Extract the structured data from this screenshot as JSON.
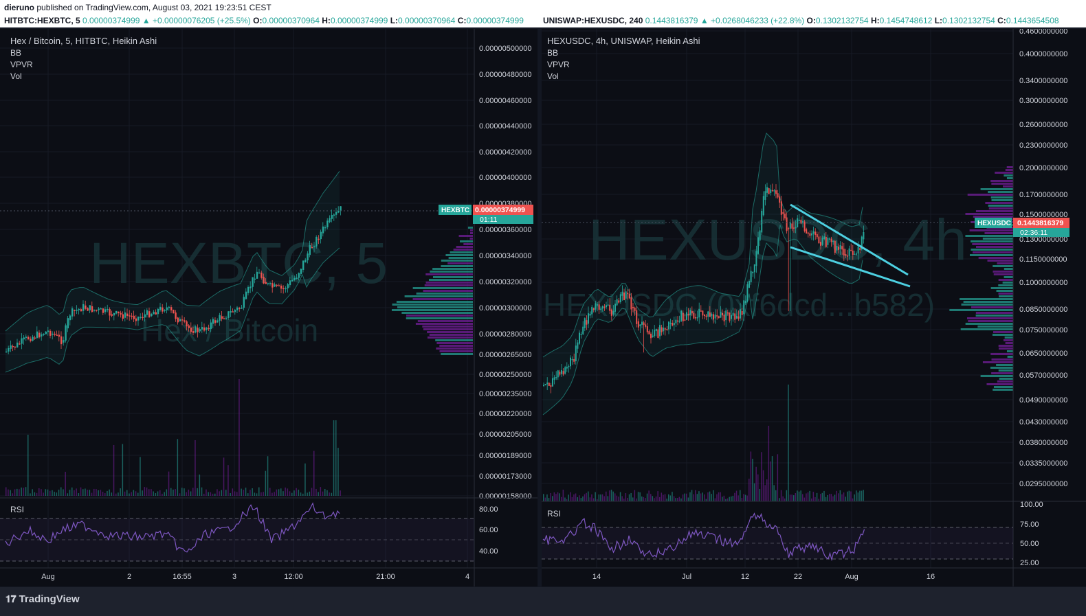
{
  "header": {
    "author": "dieruno",
    "published_text": "published on TradingView.com, August 03, 2021 19:23:51 CEST"
  },
  "left": {
    "symbol_line": "HITBTC:HEXBTC, 5",
    "last": "0.00000374999",
    "change": "+0.00000076205 (+25.5%)",
    "o_label": "O:",
    "o": "0.00000370964",
    "h_label": "H:",
    "h": "0.00000374999",
    "l_label": "L:",
    "l": "0.00000370964",
    "c_label": "C:",
    "c": "0.00000374999",
    "title": "Hex / Bitcoin, 5, HITBTC, Heikin Ashi",
    "indicators": [
      "BB",
      "VPVR",
      "Vol"
    ],
    "watermark": "HEXBTC, 5",
    "watermark_sub": "Hex / Bitcoin",
    "price_tag_symbol": "HEXBTC",
    "price_tag_value": "0.00000374999",
    "countdown": "01:11",
    "price_ticks": [
      "0.00000500000",
      "0.00000480000",
      "0.00000460000",
      "0.00000440000",
      "0.00000420000",
      "0.00000400000",
      "0.00000380000",
      "0.00000360000",
      "0.00000340000",
      "0.00000320000",
      "0.00000300000",
      "0.00000280000",
      "0.00000265000",
      "0.00000250000",
      "0.00000235000",
      "0.00000220000",
      "0.00000205000",
      "0.00000189000",
      "0.00000173000",
      "0.00000158000"
    ],
    "rsi_label": "RSI",
    "rsi_ticks": [
      "80.00",
      "60.00",
      "40.00"
    ],
    "time_ticks": [
      "Aug",
      "2",
      "16:55",
      "3",
      "12:00",
      "21:00",
      "4"
    ],
    "colors": {
      "up": "#26a69a",
      "down": "#ef5350",
      "bb": "#26a69a",
      "rsi": "#7e57c2",
      "vol": "#7b1fa2"
    }
  },
  "right": {
    "symbol_line": "UNISWAP:HEXUSDC, 240",
    "last": "0.1443816379",
    "change": "+0.0268046233 (+22.8%)",
    "o_label": "O:",
    "o": "0.1302132754",
    "h_label": "H:",
    "h": "0.1454748612",
    "l_label": "L:",
    "l": "0.1302132754",
    "c_label": "C:",
    "c": "0.1443654508",
    "title": "HEXUSDC, 4h, UNISWAP, Heikin Ashi",
    "indicators": [
      "BB",
      "VPVR",
      "Vol"
    ],
    "watermark": "HEXUSDC, 4h",
    "watermark_sub": "HEXUSDC (0xf6dcd...b582)",
    "price_tag_symbol": "HEXUSDC",
    "price_tag_value": "0.1443816379",
    "countdown": "02:36:11",
    "price_ticks": [
      "0.4600000000",
      "0.4000000000",
      "0.3400000000",
      "0.3000000000",
      "0.2600000000",
      "0.2300000000",
      "0.2000000000",
      "0.1700000000",
      "0.1500000000",
      "0.1300000000",
      "0.1150000000",
      "0.1000000000",
      "0.0850000000",
      "0.0750000000",
      "0.0650000000",
      "0.0570000000",
      "0.0490000000",
      "0.0430000000",
      "0.0380000000",
      "0.0335000000",
      "0.0295000000"
    ],
    "rsi_label": "RSI",
    "rsi_ticks": [
      "100.00",
      "75.00",
      "50.00",
      "25.00"
    ],
    "time_ticks": [
      "14",
      "Jul",
      "12",
      "22",
      "Aug",
      "16"
    ],
    "colors": {
      "up": "#26a69a",
      "down": "#ef5350",
      "wedge": "#4dd0e1",
      "rsi": "#7e57c2"
    }
  },
  "chart_data": [
    {
      "type": "candlestick",
      "title": "Hex / Bitcoin, 5, HITBTC, Heikin Ashi",
      "x_ticks": [
        "Aug",
        "2",
        "16:55",
        "3",
        "12:00",
        "21:00",
        "4"
      ],
      "approx_close_path": [
        {
          "x": "Aug 1",
          "y": 2.7e-06
        },
        {
          "x": "Aug 1 12:00",
          "y": 2.93e-06
        },
        {
          "x": "Aug 2",
          "y": 2.98e-06
        },
        {
          "x": "16:55",
          "y": 2.98e-06
        },
        {
          "x": "Aug 2 21:00",
          "y": 2.78e-06
        },
        {
          "x": "Aug 3",
          "y": 3e-06
        },
        {
          "x": "Aug 3 04:00",
          "y": 3.35e-06
        },
        {
          "x": "Aug 3 08:00",
          "y": 3.15e-06
        },
        {
          "x": "12:00",
          "y": 3.28e-06
        },
        {
          "x": "Aug 3 16:00",
          "y": 3.52e-06
        },
        {
          "x": "Aug 3 19:20",
          "y": 3.75e-06
        }
      ],
      "last_price": 3.74999e-06,
      "rsi_last": 73
    },
    {
      "type": "candlestick",
      "title": "HEXUSDC, 4h, UNISWAP, Heikin Ashi",
      "x_ticks": [
        "14",
        "Jul",
        "12",
        "22",
        "Aug",
        "16"
      ],
      "approx_close_path": [
        {
          "x": "Jun 8",
          "y": 0.052
        },
        {
          "x": "Jun 14",
          "y": 0.065
        },
        {
          "x": "Jun 20",
          "y": 0.095
        },
        {
          "x": "Jun 26",
          "y": 0.08
        },
        {
          "x": "Jul 1",
          "y": 0.072
        },
        {
          "x": "Jul 8",
          "y": 0.085
        },
        {
          "x": "Jul 12",
          "y": 0.085
        },
        {
          "x": "Jul 16",
          "y": 0.19
        },
        {
          "x": "Jul 20",
          "y": 0.16
        },
        {
          "x": "Jul 24",
          "y": 0.135
        },
        {
          "x": "Jul 30",
          "y": 0.118
        },
        {
          "x": "Aug 3",
          "y": 0.144
        }
      ],
      "last_price": 0.1443816379,
      "rsi_last": 72,
      "annotation": "falling wedge (two trendlines)"
    }
  ]
}
